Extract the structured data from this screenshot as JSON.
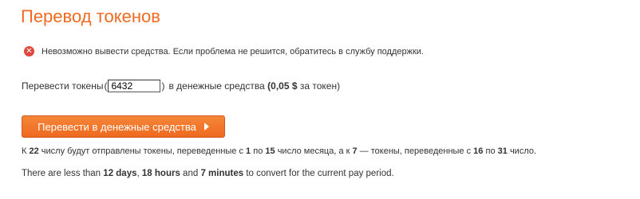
{
  "page": {
    "title": "Перевод токенов"
  },
  "alert": {
    "icon": "error-icon",
    "icon_color": "#e0483e",
    "message": "Невозможно вывести средства. Если проблема не решится, обратитесь в службу поддержки."
  },
  "convert": {
    "label": "Перевести токены",
    "open_paren": "(",
    "tokens_value": "6432",
    "close_paren": ")",
    "into_label": "в денежные средства",
    "rate_open": "(",
    "rate_value": "0,05 $",
    "rate_suffix": "за токен",
    "rate_close": ")",
    "button_label": "Перевести в денежные средства",
    "button_icon": "play-arrow-icon",
    "accent_color": "#f26a20"
  },
  "schedule": {
    "part1": "К",
    "day1": "22",
    "part2": "числу будут отправлены токены, переведенные с",
    "from1": "1",
    "part3": "по",
    "to1": "15",
    "part4": "число месяца, а к",
    "day2": "7",
    "part5": "— токены, переведенные с",
    "from2": "16",
    "part6": "по",
    "to2": "31",
    "part7": "число."
  },
  "period": {
    "part1": "There are less than",
    "days": "12 days",
    "sep1": ",",
    "hours": "18 hours",
    "part2": "and",
    "minutes": "7 minutes",
    "part3": "to convert for the current pay period."
  }
}
